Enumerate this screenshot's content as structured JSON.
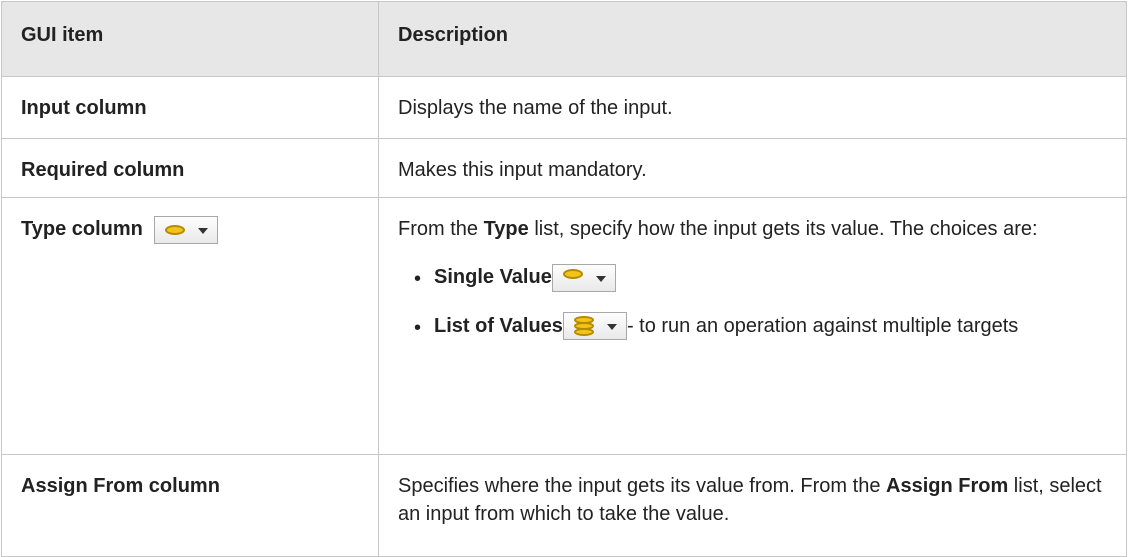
{
  "table": {
    "header": {
      "col1": "GUI item",
      "col2": "Description"
    },
    "rows": [
      {
        "item": "Input column",
        "desc": "Displays the name of the input."
      },
      {
        "item": "Required column",
        "desc": "Makes this input mandatory."
      },
      {
        "item": "Type column",
        "desc_pre": "From the ",
        "desc_bold": "Type",
        "desc_post": " list, specify how the input gets its value. The choices are:",
        "choices": [
          {
            "label": "Single Value",
            "icon": "single-value-coin-icon",
            "suffix": ""
          },
          {
            "label": "List of Values",
            "icon": "list-of-values-coins-icon",
            "suffix": "- to run an operation against multiple targets"
          }
        ]
      },
      {
        "item": "Assign From column",
        "desc_pre": "Specifies where the input gets its value from. From the ",
        "desc_bold": "Assign From",
        "desc_post": " list, select an input from which to take the value."
      }
    ]
  },
  "colors": {
    "header_bg": "#e7e7e7",
    "border": "#c7c7c7",
    "coin_fill": "#f0c419",
    "coin_edge": "#b58900"
  }
}
